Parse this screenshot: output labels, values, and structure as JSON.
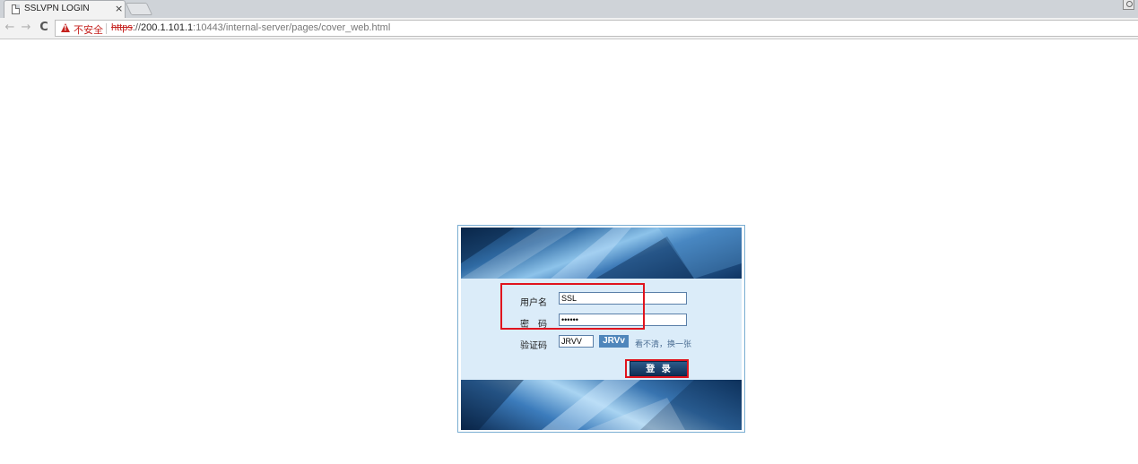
{
  "browser": {
    "tab_title": "SSLVPN LOGIN",
    "tab_close": "×",
    "nav": {
      "back": "←",
      "forward": "→",
      "reload": "C"
    },
    "security_label": "不安全",
    "url": {
      "scheme": "https",
      "separator": "://",
      "host": "200.1.101.1",
      "path": ":10443/internal-server/pages/cover_web.html"
    }
  },
  "login": {
    "username_label": "用户名",
    "username_value": "SSL",
    "password_label": "密　码",
    "password_value": "••••••",
    "captcha_label": "验证码",
    "captcha_input_value": "JRVV",
    "captcha_image_text": "JRVv",
    "refresh_link": "看不清，换一张",
    "login_button": "登 录"
  },
  "colors": {
    "highlight": "#e0141e",
    "form_background": "#dbecf9",
    "panel_border": "#7aaed2",
    "button": "#1a3f6b",
    "insecure_red": "#c5221f"
  },
  "icons": [
    "document-icon",
    "close-icon",
    "back-arrow-icon",
    "forward-arrow-icon",
    "reload-icon",
    "warning-icon",
    "profile-icon"
  ]
}
